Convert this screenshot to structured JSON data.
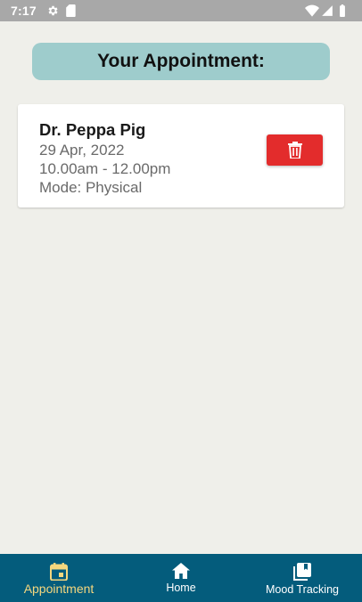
{
  "status_bar": {
    "time": "7:17",
    "icons": [
      "settings-icon",
      "sd-card-icon",
      "wifi-icon",
      "signal-icon",
      "battery-icon"
    ]
  },
  "page": {
    "title": "Your Appointment:"
  },
  "appointments": [
    {
      "doctor": "Dr. Peppa Pig",
      "date": "29 Apr, 2022",
      "time": "10.00am - 12.00pm",
      "mode": "Mode: Physical",
      "delete_icon": "trash-icon"
    }
  ],
  "bottom_nav": {
    "items": [
      {
        "label": "Appointment",
        "icon": "calendar-icon",
        "active": true
      },
      {
        "label": "Home",
        "icon": "home-icon",
        "active": false
      },
      {
        "label": "Mood Tracking",
        "icon": "library-icon",
        "active": false
      }
    ]
  },
  "colors": {
    "background": "#efefea",
    "status_bar": "#a8a8a8",
    "title_pill": "#9ecccc",
    "delete_button": "#e32c2c",
    "bottom_nav": "#045c7c",
    "nav_active": "#f5d77e"
  }
}
